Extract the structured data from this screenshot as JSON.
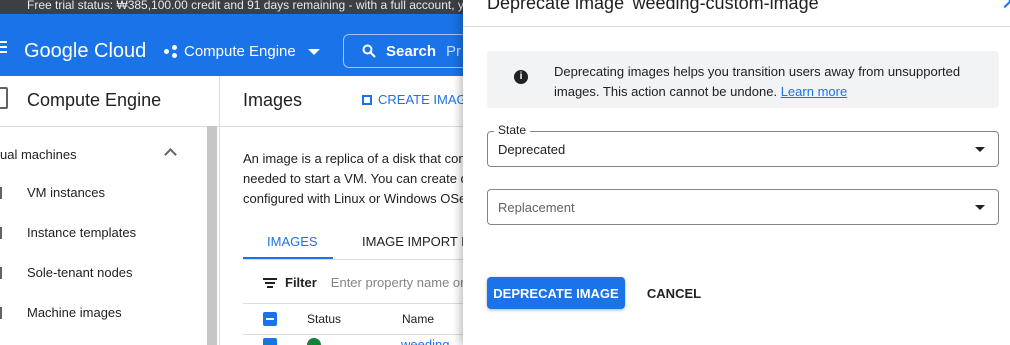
{
  "trial_banner": "Free trial status: ₩385,100.00 credit and 91 days remaining - with a full account, you",
  "header": {
    "brand": "Google Cloud",
    "product_selector": "Compute Engine",
    "search_label": "Search",
    "search_hint": "Pr"
  },
  "sidebar": {
    "title": "Compute Engine",
    "section": "ual machines",
    "items": [
      {
        "label": "VM instances"
      },
      {
        "label": "Instance templates"
      },
      {
        "label": "Sole-tenant nodes"
      },
      {
        "label": "Machine images"
      }
    ]
  },
  "main": {
    "title": "Images",
    "create_label": "CREATE IMAG",
    "description_lines": [
      "An image is a replica of a disk that con",
      "needed to start a VM. You can create c",
      "configured with Linux or Windows OSe"
    ],
    "tabs": [
      {
        "label": "IMAGES"
      },
      {
        "label": "IMAGE IMPORT H"
      }
    ],
    "filter_label": "Filter",
    "filter_placeholder": "Enter property name or",
    "columns": {
      "status": "Status",
      "name": "Name"
    },
    "row_name": "weeding"
  },
  "dialog": {
    "title": "Deprecate image 'weeding-custom-image'",
    "info_text": "Deprecating images helps you transition users away from unsupported images. This action cannot be undone.",
    "learn_more": "Learn more",
    "state_label": "State",
    "state_value": "Deprecated",
    "replacement_placeholder": "Replacement",
    "primary_button": "DEPRECATE IMAGE",
    "cancel_button": "CANCEL"
  }
}
